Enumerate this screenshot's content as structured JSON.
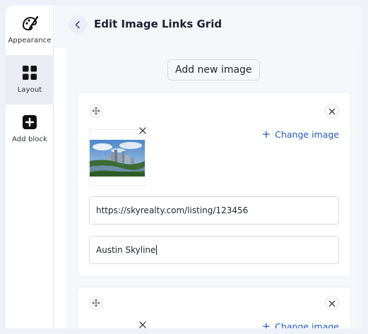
{
  "sidebar": {
    "items": [
      {
        "label": "Appearance",
        "icon": "palette-icon",
        "active": false
      },
      {
        "label": "Layout",
        "icon": "grid-icon",
        "active": true
      },
      {
        "label": "Add block",
        "icon": "plus-square-icon",
        "active": false
      }
    ]
  },
  "header": {
    "title": "Edit Image Links Grid",
    "back_icon": "chevron-left-icon"
  },
  "main": {
    "add_button_label": "Add new image",
    "cards": [
      {
        "change_image_label": "Change image",
        "link_value": "https://skyrealty.com/listing/123456",
        "caption_value": "Austin Skyline"
      },
      {
        "change_image_label": "Change image"
      }
    ]
  },
  "colors": {
    "accent": "#2457c5",
    "active_sidebar_bg": "#e9ecf2",
    "page_bg": "#eef1f8"
  }
}
